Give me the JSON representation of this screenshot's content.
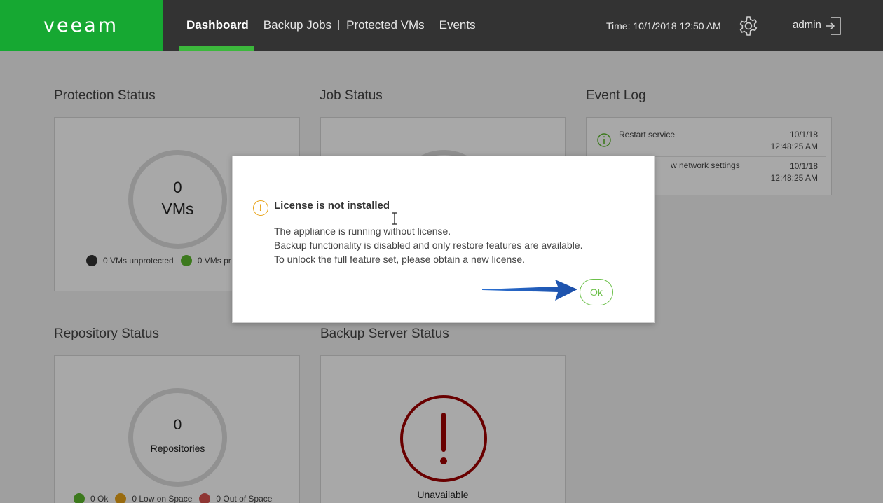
{
  "header": {
    "logo": "veeam",
    "nav": [
      {
        "label": "Dashboard",
        "active": true
      },
      {
        "label": "Backup Jobs",
        "active": false
      },
      {
        "label": "Protected VMs",
        "active": false
      },
      {
        "label": "Events",
        "active": false
      }
    ],
    "time": "Time: 10/1/2018 12:50 AM",
    "user": "admin",
    "icons": [
      "gear-icon",
      "logout-icon"
    ]
  },
  "protection_status": {
    "title": "Protection Status",
    "count": "0",
    "unit": "VMs",
    "legend": [
      {
        "label": "0 VMs unprotected",
        "color": "#333333"
      },
      {
        "label": "0 VMs pr",
        "color": "#5cb82c"
      }
    ]
  },
  "job_status": {
    "title": "Job Status"
  },
  "event_log": {
    "title": "Event Log",
    "events": [
      {
        "message": "Restart service",
        "date": "10/1/18",
        "time": "12:48:25 AM"
      },
      {
        "message": "w network settings",
        "date": "10/1/18",
        "time": "12:48:25 AM"
      }
    ]
  },
  "repository_status": {
    "title": "Repository Status",
    "count": "0",
    "unit": "Repositories",
    "legend": [
      {
        "label": "0 Ok",
        "color": "#5cb82c"
      },
      {
        "label": "0 Low on Space",
        "color": "#e8a317"
      },
      {
        "label": "0 Out of Space",
        "color": "#d9534f"
      }
    ]
  },
  "backup_server_status": {
    "title": "Backup Server Status",
    "status": "Unavailable",
    "status_color": "#a00000"
  },
  "dialog": {
    "title": "License is not installed",
    "lines": [
      "The appliance is running without license.",
      "Backup functionality is disabled and only restore features are available.",
      "To unlock the full feature set, please obtain a new license."
    ],
    "ok_label": "Ok",
    "icon": "warning-icon",
    "accent_color": "#6cc04a"
  }
}
